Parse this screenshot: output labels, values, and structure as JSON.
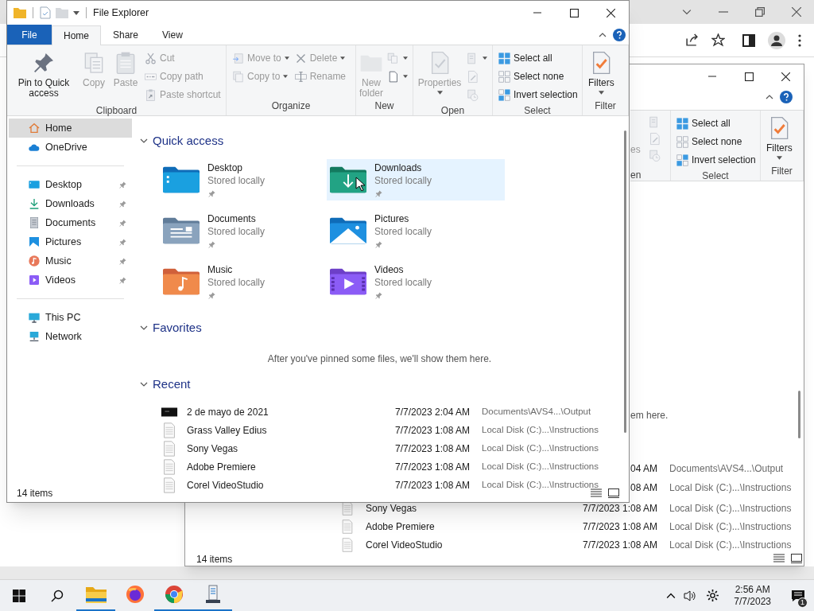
{
  "explorer": {
    "title": "File Explorer",
    "tabs": [
      {
        "label": "File",
        "kind": "file",
        "selected": false
      },
      {
        "label": "Home",
        "kind": "tab",
        "selected": true
      },
      {
        "label": "Share",
        "kind": "tab",
        "selected": false
      },
      {
        "label": "View",
        "kind": "tab",
        "selected": false
      }
    ],
    "ribbon": [
      {
        "label": "Clipboard",
        "items": [
          {
            "kind": "large",
            "label": "Pin to Quick access",
            "disabled": false
          },
          {
            "kind": "large",
            "label": "Copy",
            "disabled": true
          },
          {
            "kind": "large",
            "label": "Paste",
            "disabled": true
          },
          {
            "kind": "stack",
            "items": [
              {
                "label": "Cut",
                "disabled": true
              },
              {
                "label": "Copy path",
                "disabled": true
              },
              {
                "label": "Paste shortcut",
                "disabled": true
              }
            ]
          }
        ]
      },
      {
        "label": "Organize",
        "items": [
          {
            "kind": "stack",
            "items": [
              {
                "label": "Move to",
                "disabled": true,
                "dropdown": true
              },
              {
                "label": "Copy to",
                "disabled": true,
                "dropdown": true
              }
            ]
          },
          {
            "kind": "stack",
            "items": [
              {
                "label": "Delete",
                "disabled": true,
                "dropdown": true
              },
              {
                "label": "Rename",
                "disabled": true
              }
            ]
          }
        ]
      },
      {
        "label": "New",
        "items": [
          {
            "kind": "large",
            "label": "New folder",
            "disabled": true
          },
          {
            "kind": "stack",
            "items": [
              {
                "disabled": true,
                "dropdown": true
              },
              {
                "disabled": false,
                "dropdown": true
              }
            ]
          }
        ]
      },
      {
        "label": "Open",
        "items": [
          {
            "kind": "large",
            "label": "Properties",
            "disabled": true,
            "dropdown": true
          },
          {
            "kind": "stack",
            "items": [
              {
                "disabled": true,
                "dropdown": true
              },
              {
                "disabled": true
              },
              {
                "disabled": true
              }
            ]
          }
        ]
      },
      {
        "label": "Select",
        "items": [
          {
            "kind": "stack",
            "items": [
              {
                "label": "Select all",
                "disabled": false
              },
              {
                "label": "Select none",
                "disabled": false
              },
              {
                "label": "Invert selection",
                "disabled": false
              }
            ]
          }
        ]
      },
      {
        "label": "Filter",
        "items": [
          {
            "kind": "large",
            "label": "Filters",
            "disabled": false,
            "dropdown": true
          }
        ]
      }
    ],
    "nav": [
      {
        "items": [
          {
            "label": "Home",
            "selected": true,
            "pinned": false
          },
          {
            "label": "OneDrive",
            "selected": false,
            "pinned": false
          }
        ]
      },
      {
        "items": [
          {
            "label": "Desktop",
            "selected": false,
            "pinned": true
          },
          {
            "label": "Downloads",
            "selected": false,
            "pinned": true
          },
          {
            "label": "Documents",
            "selected": false,
            "pinned": true
          },
          {
            "label": "Pictures",
            "selected": false,
            "pinned": true
          },
          {
            "label": "Music",
            "selected": false,
            "pinned": true
          },
          {
            "label": "Videos",
            "selected": false,
            "pinned": true
          }
        ]
      },
      {
        "items": [
          {
            "label": "This PC",
            "selected": false,
            "pinned": false
          },
          {
            "label": "Network",
            "selected": false,
            "pinned": false
          }
        ]
      }
    ],
    "sections": [
      {
        "title": "Quick access",
        "expanded": true,
        "kind": "tiles",
        "tiles": [
          {
            "name": "Desktop",
            "subtitle": "Stored locally",
            "pinned": true,
            "selected": false
          },
          {
            "name": "Downloads",
            "subtitle": "Stored locally",
            "pinned": true,
            "selected": true
          },
          {
            "name": "Documents",
            "subtitle": "Stored locally",
            "pinned": true,
            "selected": false
          },
          {
            "name": "Pictures",
            "subtitle": "Stored locally",
            "pinned": true,
            "selected": false
          },
          {
            "name": "Music",
            "subtitle": "Stored locally",
            "pinned": true,
            "selected": false
          },
          {
            "name": "Videos",
            "subtitle": "Stored locally",
            "pinned": true,
            "selected": false
          }
        ]
      },
      {
        "title": "Favorites",
        "expanded": true,
        "kind": "message",
        "message": "After you've pinned some files, we'll show them here."
      },
      {
        "title": "Recent",
        "expanded": true,
        "kind": "list",
        "rows": [
          {
            "name": "2 de mayo de 2021",
            "date": "7/7/2023 2:04 AM",
            "location": "Documents\\AVS4...\\Output",
            "kind": "video"
          },
          {
            "name": "Grass Valley Edius",
            "date": "7/7/2023 1:08 AM",
            "location": "Local Disk (C:)...\\Instructions",
            "kind": "text"
          },
          {
            "name": "Sony Vegas",
            "date": "7/7/2023 1:08 AM",
            "location": "Local Disk (C:)...\\Instructions",
            "kind": "text"
          },
          {
            "name": "Adobe Premiere",
            "date": "7/7/2023 1:08 AM",
            "location": "Local Disk (C:)...\\Instructions",
            "kind": "text"
          },
          {
            "name": "Corel VideoStudio",
            "date": "7/7/2023 1:08 AM",
            "location": "Local Disk (C:)...\\Instructions",
            "kind": "text"
          }
        ]
      }
    ],
    "status_bar": "14 items"
  },
  "background_explorer": {
    "ribbon_fragments": [
      "es",
      "en"
    ],
    "groups": [
      {
        "label": "Select",
        "items": [
          {
            "kind": "stack",
            "items": [
              {
                "label": "Select all",
                "disabled": false
              },
              {
                "label": "Select none",
                "disabled": false
              },
              {
                "label": "Invert selection",
                "disabled": false
              }
            ]
          }
        ]
      },
      {
        "label": "Filter",
        "items": [
          {
            "kind": "large",
            "label": "Filters",
            "disabled": false,
            "dropdown": true
          }
        ]
      }
    ],
    "message_fragment": "em here.",
    "right_rows": [
      {
        "date": "04 AM",
        "location": "Documents\\AVS4...\\Output"
      },
      {
        "date": "08 AM",
        "location": "Local Disk (C:)...\\Instructions"
      }
    ],
    "bottom_rows": [
      {
        "name": "Sony Vegas",
        "date": "7/7/2023 1:08 AM",
        "location": "Local Disk (C:)...\\Instructions",
        "kind": "text"
      },
      {
        "name": "Adobe Premiere",
        "date": "7/7/2023 1:08 AM",
        "location": "Local Disk (C:)...\\Instructions",
        "kind": "text"
      },
      {
        "name": "Corel VideoStudio",
        "date": "7/7/2023 1:08 AM",
        "location": "Local Disk (C:)...\\Instructions",
        "kind": "text"
      }
    ],
    "status_bar": "14 items"
  },
  "taskbar": {
    "apps": [
      {
        "kind": "folder",
        "running": true
      },
      {
        "kind": "firefox",
        "running": false
      },
      {
        "kind": "chrome",
        "running": true
      },
      {
        "kind": "app",
        "running": true
      }
    ],
    "time": "2:56 AM",
    "date": "7/7/2023",
    "notification_count": "1"
  }
}
